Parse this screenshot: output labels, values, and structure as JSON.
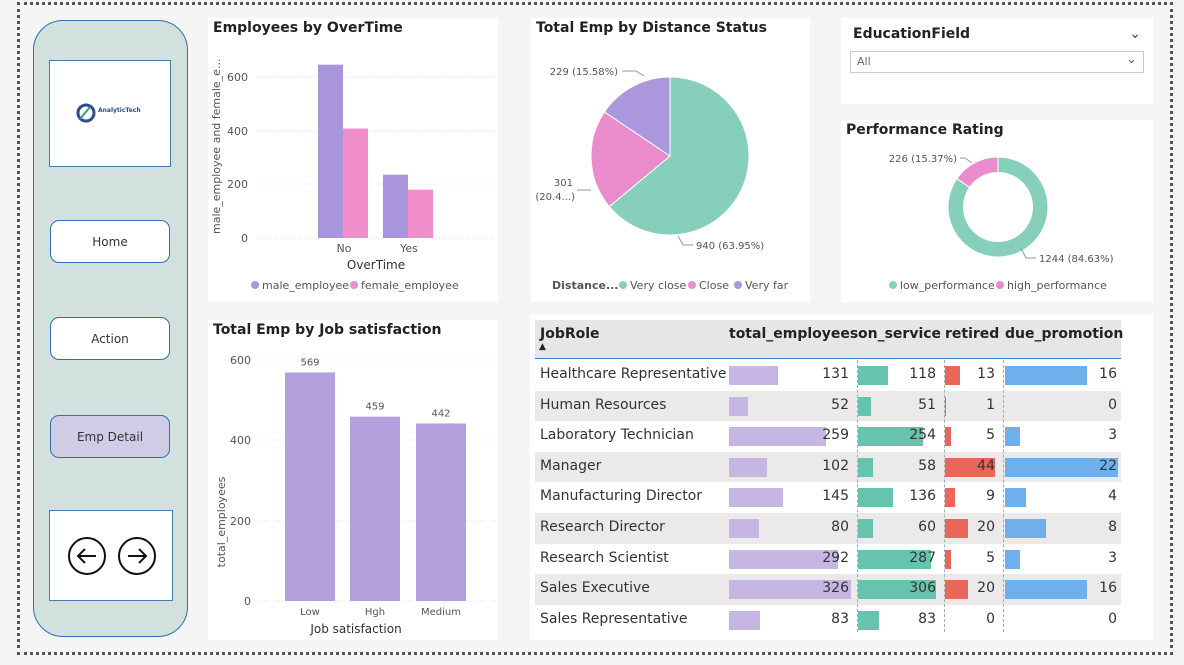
{
  "sidebar": {
    "logo_text": "AnalyticTech",
    "buttons": [
      "Home",
      "Action",
      "Emp Detail"
    ]
  },
  "overtime_chart": {
    "title": "Employees by OverTime",
    "ylabel": "male_employee and female_e...",
    "xlabel": "OverTime",
    "yticks": [
      "600",
      "400",
      "200",
      "0"
    ],
    "legend": [
      "male_employee",
      "female_employee"
    ]
  },
  "distance_chart": {
    "title": "Total Emp by Distance Status",
    "labels": [
      "229 (15.58%)",
      "301",
      "(20.4...)",
      "940 (63.95%)"
    ],
    "legend_title": "Distance...",
    "legend": [
      "Very close",
      "Close",
      "Very far"
    ]
  },
  "education_filter": {
    "label": "EducationField",
    "value": "All"
  },
  "performance_chart": {
    "title": "Performance Rating",
    "labels": [
      "226 (15.37%)",
      "1244 (84.63%)"
    ],
    "legend": [
      "low_performance",
      "high_performance"
    ]
  },
  "jobsat_chart": {
    "title": "Total Emp by Job satisfaction",
    "ylabel": "total_employees",
    "xlabel": "Job satisfaction",
    "yticks": [
      "600",
      "400",
      "200",
      "0"
    ]
  },
  "table": {
    "headers": [
      "JobRole",
      "total_employees",
      "on_service",
      "retired",
      "due_promotion"
    ],
    "sort_icon": "▲",
    "rows": [
      {
        "role": "Healthcare Representative",
        "total": "131",
        "on": "118",
        "ret": "13",
        "due": "16"
      },
      {
        "role": "Human Resources",
        "total": "52",
        "on": "51",
        "ret": "1",
        "due": "0"
      },
      {
        "role": "Laboratory Technician",
        "total": "259",
        "on": "254",
        "ret": "5",
        "due": "3"
      },
      {
        "role": "Manager",
        "total": "102",
        "on": "58",
        "ret": "44",
        "due": "22"
      },
      {
        "role": "Manufacturing Director",
        "total": "145",
        "on": "136",
        "ret": "9",
        "due": "4"
      },
      {
        "role": "Research Director",
        "total": "80",
        "on": "60",
        "ret": "20",
        "due": "8"
      },
      {
        "role": "Research Scientist",
        "total": "292",
        "on": "287",
        "ret": "5",
        "due": "3"
      },
      {
        "role": "Sales Executive",
        "total": "326",
        "on": "306",
        "ret": "20",
        "due": "16"
      },
      {
        "role": "Sales Representative",
        "total": "83",
        "on": "83",
        "ret": "0",
        "due": "0"
      }
    ]
  },
  "chart_data": [
    {
      "type": "bar",
      "title": "Employees by OverTime",
      "xlabel": "OverTime",
      "ylabel": "male_employee and female_e...",
      "categories": [
        "No",
        "Yes"
      ],
      "series": [
        {
          "name": "male_employee",
          "values": [
            646,
            236
          ],
          "color": "#a895dc"
        },
        {
          "name": "female_employee",
          "values": [
            408,
            180
          ],
          "color": "#ef8ecb"
        }
      ],
      "ylim": [
        0,
        700
      ]
    },
    {
      "type": "pie",
      "title": "Total Emp by Distance Status",
      "categories": [
        "Very close",
        "Close",
        "Very far"
      ],
      "values": [
        940,
        301,
        229
      ],
      "colors": [
        "#86d0bb",
        "#ea8ccb",
        "#ab97dc"
      ]
    },
    {
      "type": "pie",
      "title": "Performance Rating",
      "categories": [
        "low_performance",
        "high_performance"
      ],
      "values": [
        1244,
        226
      ],
      "colors": [
        "#86d0bb",
        "#ea8ccb"
      ]
    },
    {
      "type": "bar",
      "title": "Total Emp by Job satisfaction",
      "xlabel": "Job satisfaction",
      "ylabel": "total_employees",
      "categories": [
        "Low",
        "Hgh",
        "Medium"
      ],
      "values": [
        569,
        459,
        442
      ],
      "ylim": [
        0,
        600
      ],
      "color": "#b3a0dc"
    }
  ]
}
